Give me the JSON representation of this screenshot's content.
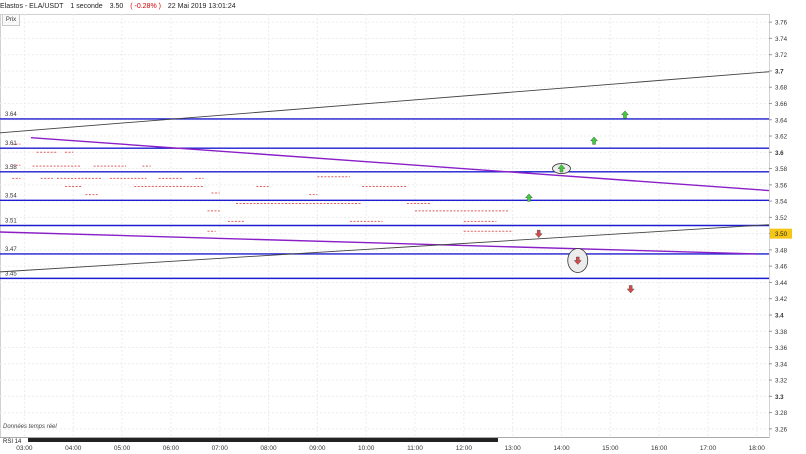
{
  "header": {
    "instrument": "Elastos - ELA/USDT",
    "interval": "1 seconde",
    "last": "3.50",
    "change": "( -0.28% )",
    "datetime": "22 Mai 2019 13:01:24"
  },
  "panel_label": "Prix",
  "footer_note": "Données temps réel",
  "rsi_label": "RSI 14",
  "colors": {
    "support_line": "#1c1cd0",
    "trend_purple": "#8a1fc8",
    "trend_black": "#444444",
    "tick_dots": "#e06060",
    "arrow_up": "#3ccc3c",
    "arrow_down": "#d64a4a",
    "price_badge": "#f5c518"
  },
  "chart_data": {
    "type": "line",
    "x_ticks": [
      "03:00",
      "04:00",
      "05:00",
      "06:00",
      "07:00",
      "08:00",
      "09:00",
      "10:00",
      "11:00",
      "12:00",
      "13:00",
      "14:00",
      "15:00",
      "16:00",
      "17:00",
      "18:00"
    ],
    "y_ticks": [
      "3.76",
      "3.74",
      "3.72",
      "3.7",
      "3.68",
      "3.66",
      "3.64",
      "3.62",
      "3.6",
      "3.58",
      "3.56",
      "3.54",
      "3.52",
      "3.50",
      "3.48",
      "3.46",
      "3.44",
      "3.42",
      "3.4",
      "3.38",
      "3.36",
      "3.34",
      "3.32",
      "3.3",
      "3.28",
      "3.26"
    ],
    "ylim": [
      3.25,
      3.77
    ],
    "xlim": [
      "02:30",
      "18:15"
    ],
    "current_price": "3.50",
    "horizontal_levels": [
      {
        "label": "3.64",
        "value": 3.641
      },
      {
        "label": "3.61",
        "value": 3.605
      },
      {
        "label": "3.58",
        "value": 3.576
      },
      {
        "label": "3.54",
        "value": 3.541
      },
      {
        "label": "3.51",
        "value": 3.51
      },
      {
        "label": "3.47",
        "value": 3.475
      },
      {
        "label": "3.45",
        "value": 3.445
      }
    ],
    "trend_lines": [
      {
        "color": "purple",
        "x": [
          "03:08",
          "18:15"
        ],
        "y": [
          3.618,
          3.553
        ]
      },
      {
        "color": "purple",
        "x": [
          "02:30",
          "18:00"
        ],
        "y": [
          3.502,
          3.475
        ]
      },
      {
        "color": "black",
        "x": [
          "02:30",
          "18:15"
        ],
        "y": [
          3.624,
          3.699
        ]
      },
      {
        "color": "black",
        "x": [
          "02:30",
          "18:15"
        ],
        "y": [
          3.453,
          3.511
        ]
      }
    ],
    "signals": [
      {
        "type": "up",
        "x": "13:20",
        "y": 3.544
      },
      {
        "type": "up",
        "x": "14:00",
        "y": 3.58,
        "circled": true
      },
      {
        "type": "up",
        "x": "14:40",
        "y": 3.614
      },
      {
        "type": "up",
        "x": "15:18",
        "y": 3.646
      },
      {
        "type": "down",
        "x": "13:32",
        "y": 3.5
      },
      {
        "type": "down",
        "x": "14:20",
        "y": 3.467,
        "circled": true
      },
      {
        "type": "down",
        "x": "15:25",
        "y": 3.432
      }
    ],
    "tick_dots": [
      {
        "x0": "02:45",
        "x1": "02:55",
        "y": 3.61
      },
      {
        "x0": "03:15",
        "x1": "03:40",
        "y": 3.6
      },
      {
        "x0": "03:50",
        "x1": "04:00",
        "y": 3.6
      },
      {
        "x0": "02:45",
        "x1": "02:55",
        "y": 3.584
      },
      {
        "x0": "03:10",
        "x1": "04:10",
        "y": 3.583
      },
      {
        "x0": "04:25",
        "x1": "05:05",
        "y": 3.583
      },
      {
        "x0": "05:25",
        "x1": "05:35",
        "y": 3.583
      },
      {
        "x0": "02:45",
        "x1": "02:55",
        "y": 3.568
      },
      {
        "x0": "03:20",
        "x1": "03:35",
        "y": 3.568
      },
      {
        "x0": "03:40",
        "x1": "04:35",
        "y": 3.568
      },
      {
        "x0": "04:45",
        "x1": "05:30",
        "y": 3.568
      },
      {
        "x0": "05:45",
        "x1": "06:15",
        "y": 3.568
      },
      {
        "x0": "06:30",
        "x1": "06:40",
        "y": 3.568
      },
      {
        "x0": "05:15",
        "x1": "06:40",
        "y": 3.558
      },
      {
        "x0": "03:50",
        "x1": "04:10",
        "y": 3.558
      },
      {
        "x0": "04:15",
        "x1": "04:30",
        "y": 3.548
      },
      {
        "x0": "06:50",
        "x1": "07:00",
        "y": 3.55
      },
      {
        "x0": "09:00",
        "x1": "09:40",
        "y": 3.57
      },
      {
        "x0": "09:55",
        "x1": "10:50",
        "y": 3.558
      },
      {
        "x0": "07:45",
        "x1": "08:00",
        "y": 3.558
      },
      {
        "x0": "08:50",
        "x1": "09:00",
        "y": 3.548
      },
      {
        "x0": "07:20",
        "x1": "09:55",
        "y": 3.537
      },
      {
        "x0": "10:50",
        "x1": "11:20",
        "y": 3.537
      },
      {
        "x0": "06:45",
        "x1": "07:00",
        "y": 3.528
      },
      {
        "x0": "11:00",
        "x1": "12:55",
        "y": 3.528
      },
      {
        "x0": "07:10",
        "x1": "07:30",
        "y": 3.515
      },
      {
        "x0": "09:40",
        "x1": "10:20",
        "y": 3.515
      },
      {
        "x0": "12:00",
        "x1": "12:40",
        "y": 3.515
      },
      {
        "x0": "06:45",
        "x1": "06:55",
        "y": 3.503
      },
      {
        "x0": "12:00",
        "x1": "13:00",
        "y": 3.503
      }
    ]
  }
}
